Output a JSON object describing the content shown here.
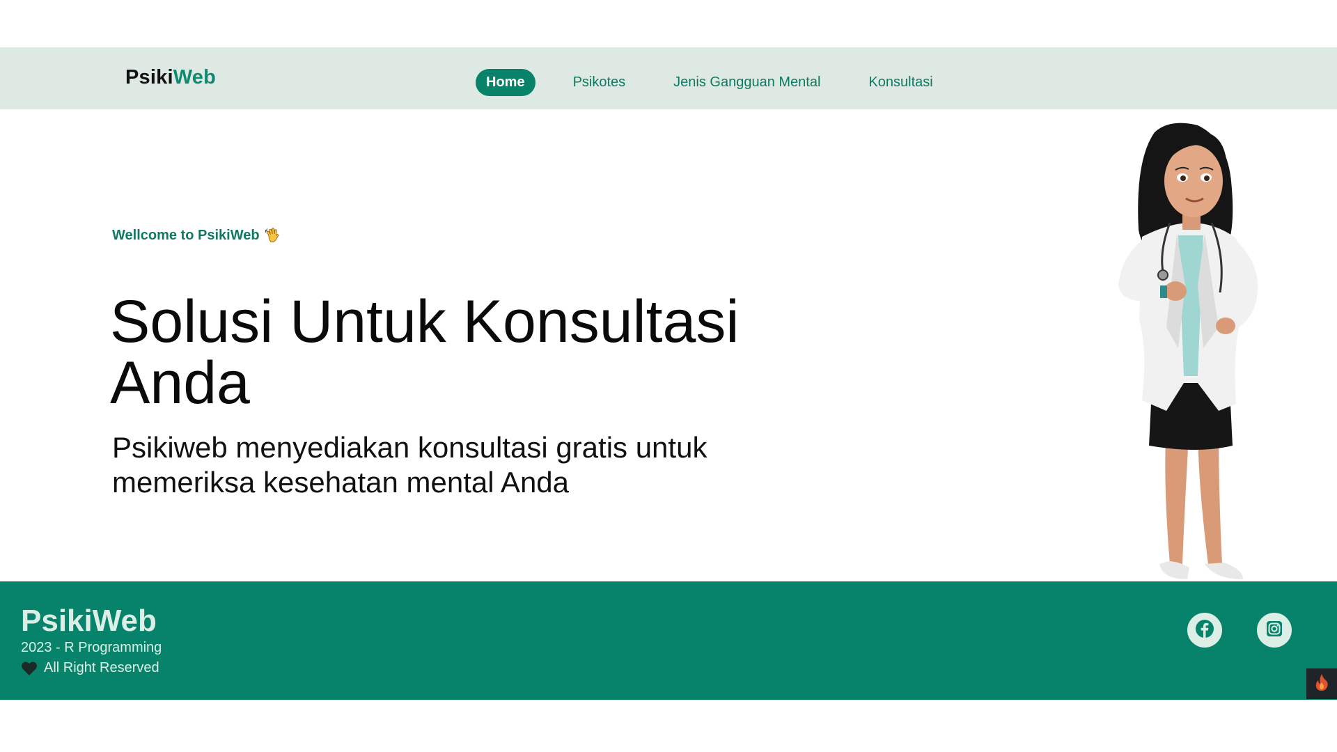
{
  "navbar": {
    "brand_part1": "Psiki",
    "brand_part2": "Web",
    "links": [
      {
        "label": "Home",
        "active": true
      },
      {
        "label": "Psikotes",
        "active": false
      },
      {
        "label": "Jenis Gangguan Mental",
        "active": false
      },
      {
        "label": "Konsultasi",
        "active": false
      }
    ]
  },
  "hero": {
    "welcome": "Wellcome to PsikiWeb",
    "welcome_icon": "waving-hand-icon",
    "title": "Solusi Untuk Konsultasi Anda",
    "subtitle": "Psikiweb menyediakan konsultasi gratis untuk memeriksa kesehatan mental Anda",
    "illustration": "doctor-illustration"
  },
  "footer": {
    "brand": "PsikiWeb",
    "line1": "2023 - R Programming",
    "line2": "All Right Reserved",
    "heart_icon": "black-heart-icon",
    "social": [
      "facebook-icon",
      "instagram-icon"
    ]
  },
  "colors": {
    "nav_bg": "#dfe9e3",
    "accent": "#088268",
    "footer_bg": "#07836c",
    "footer_text": "#dcefe7"
  }
}
